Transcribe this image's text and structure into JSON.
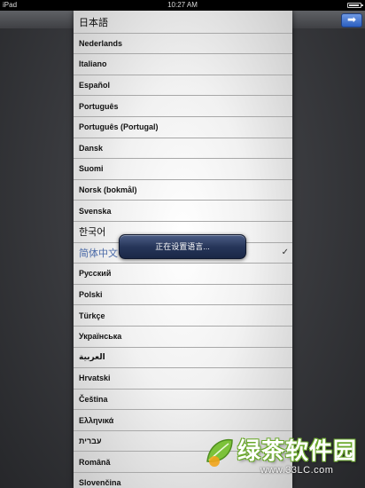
{
  "status_bar": {
    "device": "iPad",
    "time": "10:27 AM"
  },
  "next_button": {
    "icon": "arrow-right-icon",
    "glyph": "➡",
    "color": "#3a6fd0"
  },
  "languages": [
    {
      "label": "日本語"
    },
    {
      "label": "Nederlands"
    },
    {
      "label": "Italiano"
    },
    {
      "label": "Español"
    },
    {
      "label": "Português"
    },
    {
      "label": "Português (Portugal)"
    },
    {
      "label": "Dansk"
    },
    {
      "label": "Suomi"
    },
    {
      "label": "Norsk (bokmål)"
    },
    {
      "label": "Svenska"
    },
    {
      "label": "한국어"
    },
    {
      "label": "简体中文",
      "selected": true,
      "check": "✓"
    },
    {
      "label": "Русский"
    },
    {
      "label": "Polski"
    },
    {
      "label": "Türkçe"
    },
    {
      "label": "Українська"
    },
    {
      "label": "العربية"
    },
    {
      "label": "Hrvatski"
    },
    {
      "label": "Čeština"
    },
    {
      "label": "Ελληνικά"
    },
    {
      "label": "עברית"
    },
    {
      "label": "Română"
    },
    {
      "label": "Slovenčina"
    }
  ],
  "hud": {
    "text": "正在设置语言..."
  },
  "watermark": {
    "brand": "绿茶软件园",
    "url": "www.33LC.com",
    "accent": "#6aa82b"
  }
}
